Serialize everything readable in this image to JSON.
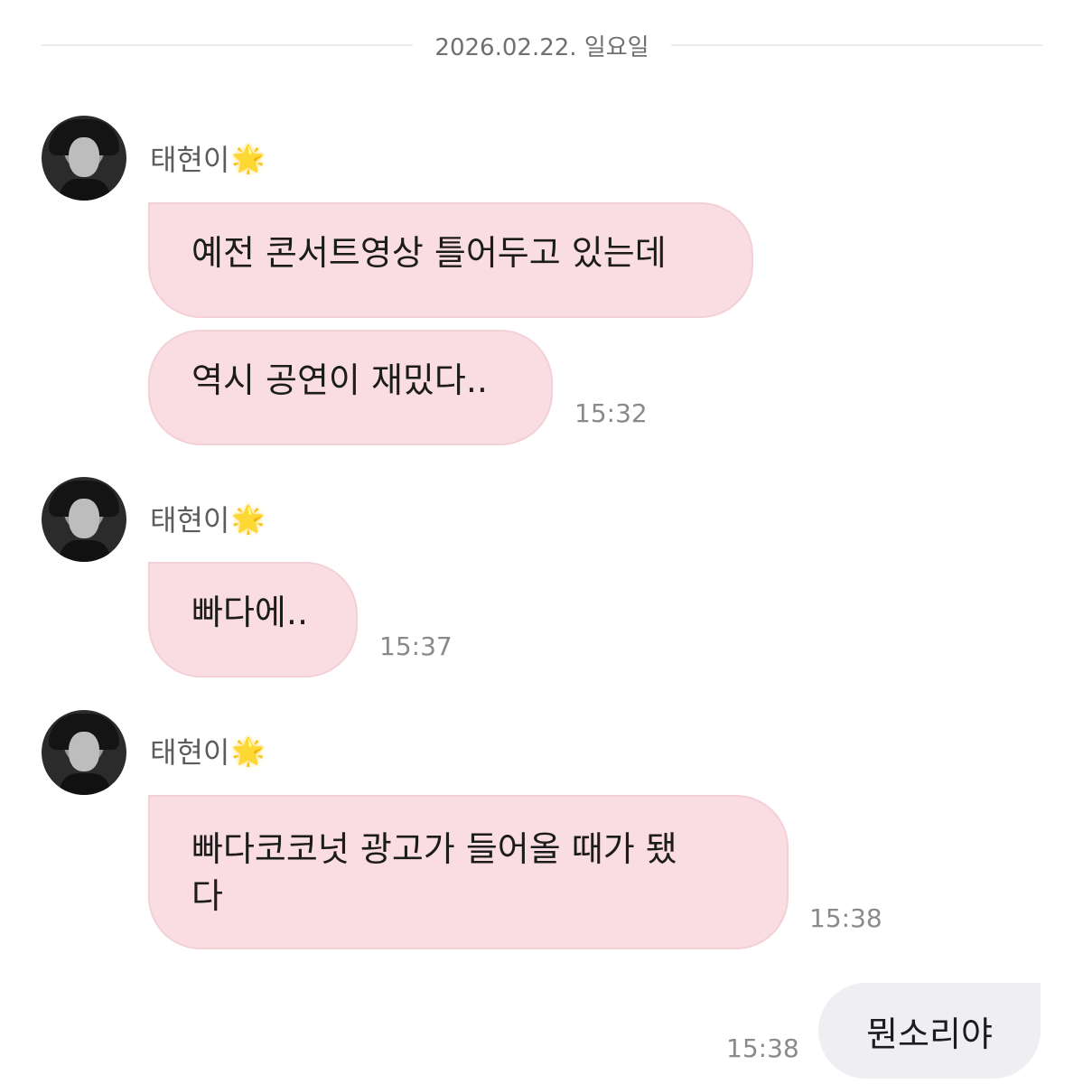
{
  "date_separator": "2026.02.22. 일요일",
  "messages": [
    {
      "sender": "태현이",
      "sender_emoji": "🌟",
      "bubbles": [
        "예전 콘서트영상 틀어두고 있는데",
        "역시 공연이 재밌다.."
      ],
      "time": "15:32"
    },
    {
      "sender": "태현이",
      "sender_emoji": "🌟",
      "bubbles": [
        "빠다에.."
      ],
      "time": "15:37"
    },
    {
      "sender": "태현이",
      "sender_emoji": "🌟",
      "bubbles": [
        "빠다코코넛 광고가 들어올 때가 됐다"
      ],
      "time": "15:38"
    }
  ],
  "my_message": {
    "text": "뭔소리야",
    "time": "15:38"
  },
  "colors": {
    "incoming_bubble": "#fadde2",
    "outgoing_bubble": "#eeeef3",
    "time_text": "#8a8a8a"
  }
}
